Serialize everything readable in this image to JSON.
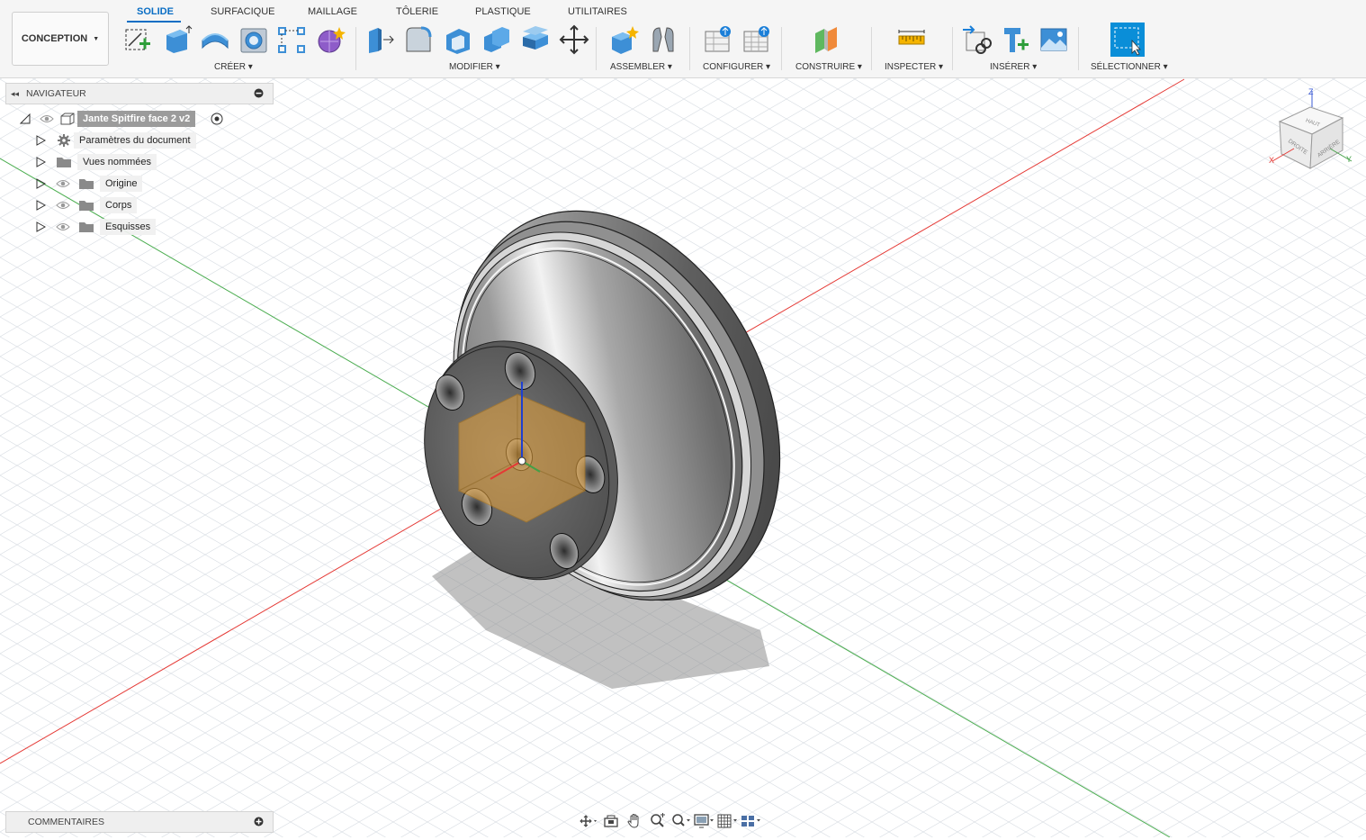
{
  "workspace": {
    "label": "CONCEPTION"
  },
  "tabs": [
    {
      "label": "SOLIDE",
      "active": true
    },
    {
      "label": "SURFACIQUE"
    },
    {
      "label": "MAILLAGE"
    },
    {
      "label": "TÔLERIE"
    },
    {
      "label": "PLASTIQUE"
    },
    {
      "label": "UTILITAIRES"
    }
  ],
  "groups": {
    "create": "CRÉER",
    "modify": "MODIFIER",
    "assemble": "ASSEMBLER",
    "configure": "CONFIGURER",
    "construct": "CONSTRUIRE",
    "inspect": "INSPECTER",
    "insert": "INSÉRER",
    "select": "SÉLECTIONNER"
  },
  "navigator": {
    "title": "NAVIGATEUR",
    "root": "Jante Spitfire face 2 v2",
    "items": [
      "Paramètres du document",
      "Vues nommées",
      "Origine",
      "Corps",
      "Esquisses"
    ]
  },
  "comments": {
    "title": "COMMENTAIRES"
  },
  "viewcube": {
    "top": "HAUT",
    "front": "DROITE",
    "back": "ARRIÈRE",
    "x": "X",
    "y": "Y",
    "z": "Z"
  },
  "colors": {
    "accent": "#0a6ec4",
    "x_axis": "#e53935",
    "y_axis": "#43a047",
    "z_axis": "#1e3fd0",
    "selection": "#e8a33a"
  },
  "icons": [
    "create-sketch-icon",
    "extrude-icon",
    "revolve-icon",
    "hole-icon",
    "pattern-icon",
    "create-form-icon",
    "press-pull-icon",
    "fillet-icon",
    "shell-icon",
    "combine-icon",
    "offset-face-icon",
    "move-icon",
    "new-component-icon",
    "joint-icon",
    "parameters-icon",
    "table-icon",
    "plane-icon",
    "measure-icon",
    "insert-derive-icon",
    "insert-mcmaster-icon",
    "canvas-icon",
    "select-icon"
  ]
}
